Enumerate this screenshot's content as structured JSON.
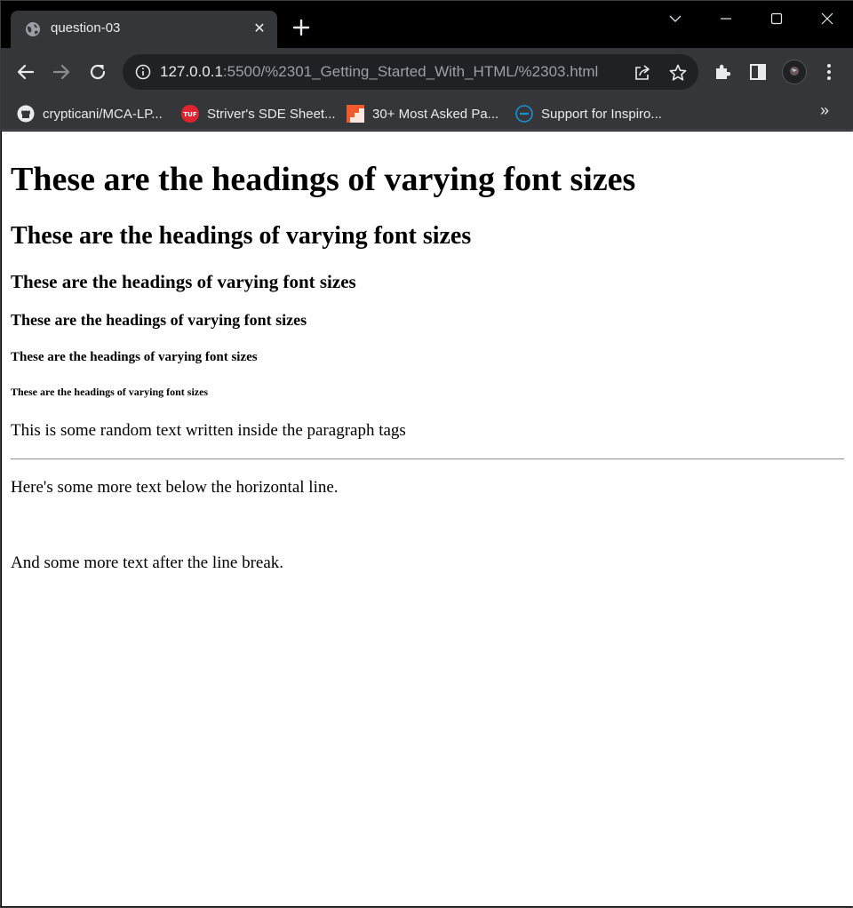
{
  "browser": {
    "tab": {
      "title": "question-03",
      "favicon": "globe-icon",
      "close_glyph": "✕"
    },
    "new_tab_icon": "plus-icon",
    "window_controls": [
      "tab-search-icon",
      "minimize-icon",
      "maximize-icon",
      "close-window-icon"
    ],
    "toolbar": {
      "back_icon": "back-arrow-icon",
      "forward_icon": "forward-arrow-icon",
      "reload_icon": "reload-icon",
      "url_host": "127.0.0.1",
      "url_rest": ":5500/%2301_Getting_Started_With_HTML/%2303.html",
      "share_icon": "share-icon",
      "bookmark_star_icon": "star-icon",
      "extensions_icon": "puzzle-icon",
      "side_panel_icon": "side-panel-icon",
      "menu_icon": "kebab-menu-icon"
    },
    "bookmarks": [
      {
        "label": "crypticani/MCA-LP...",
        "icon": "github-icon"
      },
      {
        "label": "Striver's SDE Sheet...",
        "icon": "tuf-icon"
      },
      {
        "label": "30+ Most Asked Pa...",
        "icon": "stairs-icon"
      },
      {
        "label": "Support for Inspiro...",
        "icon": "dell-icon"
      }
    ],
    "bookmarks_overflow": "»",
    "colors": {
      "frame": "#000000",
      "toolbar": "#35363a",
      "omnibox": "#202124",
      "text": "#e8eaed"
    }
  },
  "page": {
    "h1": "These are the headings of varying font sizes",
    "h2": "These are the headings of varying font sizes",
    "h3": "These are the headings of varying font sizes",
    "h4": "These are the headings of varying font sizes",
    "h5": "These are the headings of varying font sizes",
    "h6": "These are the headings of varying font sizes",
    "paragraph": "This is some random text written inside the paragraph tags",
    "after_hr": "Here's some more text below the horizontal line.",
    "after_br": "And some more text after the line break."
  }
}
